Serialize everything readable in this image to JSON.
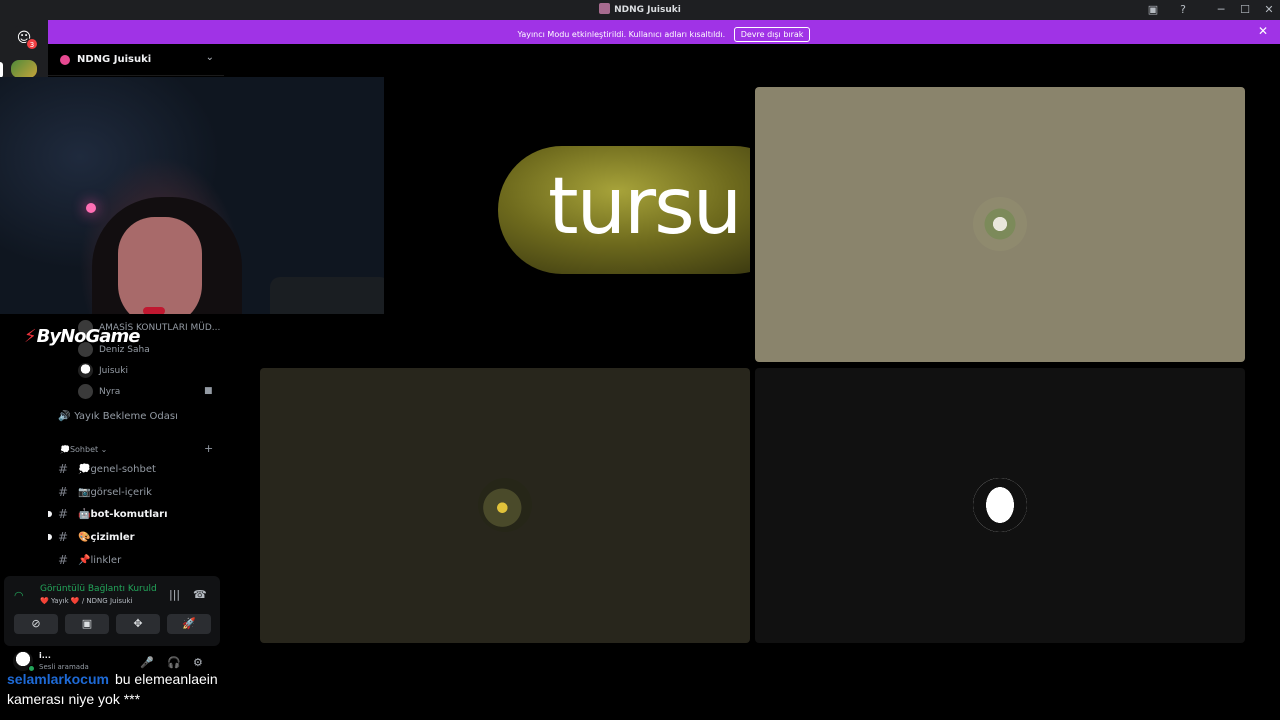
{
  "window": {
    "title": "NDNG Juisuki",
    "controls": {
      "minimize": "─",
      "maximize": "☐",
      "close": "✕",
      "inbox": "▣",
      "help": "?"
    }
  },
  "rail": {
    "home_badge": "3"
  },
  "banner": {
    "message": "Yayıncı Modu etkinleştirildi. Kullanıcı adları kısaltıldı.",
    "button": "Devre dışı bırak",
    "close": "✕",
    "color": "#a033e6"
  },
  "guild": {
    "name": "NDNG Juisuki",
    "chevron": "⌄"
  },
  "watermark": "ByNoGame",
  "voice_members": [
    {
      "name": "AMASİS KONUTLARI MÜD..."
    },
    {
      "name": "Deniz Saha"
    },
    {
      "name": "Juisuki"
    },
    {
      "name": "Nyra",
      "camera": "■"
    }
  ],
  "voice_channel_wait": {
    "icon": "🔊",
    "label": "Yayık Bekleme Odası"
  },
  "category": {
    "label": "💭Sohbet ⌄",
    "add": "+"
  },
  "channels": [
    {
      "label": "💭genel-sohbet",
      "bright": false
    },
    {
      "label": "📷görsel-içerik",
      "bright": false
    },
    {
      "label": "🤖bot-komutları",
      "bright": true
    },
    {
      "label": "🎨çizimler",
      "bright": true
    },
    {
      "label": "📌linkler",
      "bright": false
    }
  ],
  "voice_panel": {
    "status": "Görüntülü Bağlantı Kuruld",
    "location": "❤️ Yayık ❤️ / NDNG Juisuki",
    "noise_icon": "|||",
    "hangup_icon": "☎",
    "buttons": [
      "⊘",
      "▣",
      "✥",
      "🚀"
    ]
  },
  "user_panel": {
    "name": "i...",
    "status": "Sesli aramada",
    "controls": [
      "🎤",
      "🎧",
      "⚙"
    ]
  },
  "stage": {
    "pickle_text": "tursu"
  },
  "chat": {
    "user": "selamlarkocum",
    "message_line1": "bu elemeanlaein",
    "message_line2": "kamerası niye yok ***"
  }
}
